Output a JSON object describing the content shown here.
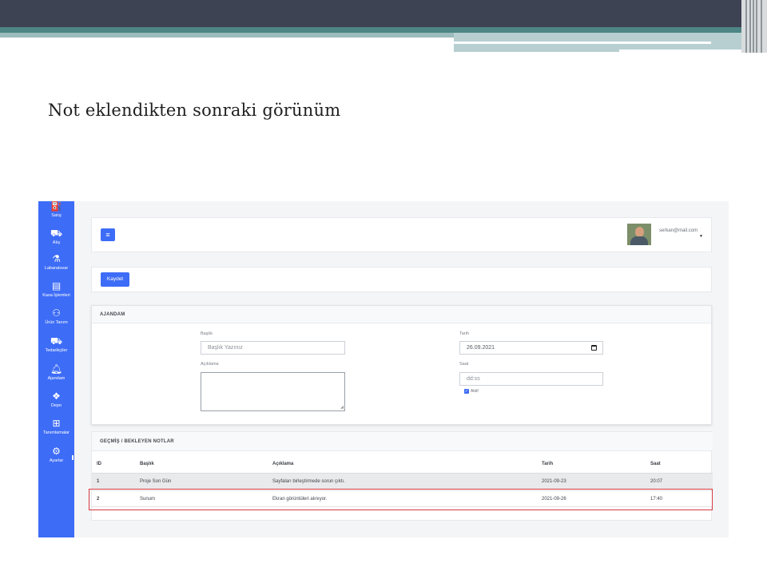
{
  "slide": {
    "title": "Not eklendikten sonraki görünüm"
  },
  "sidebar": {
    "items": [
      {
        "label": "Satış",
        "icon": "basket-icon"
      },
      {
        "label": "Alış",
        "icon": "truck-icon"
      },
      {
        "label": "Labaratuvar",
        "icon": "flask-icon"
      },
      {
        "label": "Kasa İşlemleri",
        "icon": "cash-register-icon"
      },
      {
        "label": "Ürün Tanım",
        "icon": "people-carry-icon"
      },
      {
        "label": "Tedarikçiler",
        "icon": "truck-icon"
      },
      {
        "label": "Ajandam",
        "icon": "bell-icon"
      },
      {
        "label": "Depo",
        "icon": "dropbox-icon"
      },
      {
        "label": "Tanımlamalar",
        "icon": "plus-square-icon"
      },
      {
        "label": "Ayarlar",
        "icon": "gear-icon"
      }
    ]
  },
  "header": {
    "menu_icon": "≡",
    "user_email": "serkan@mail.com"
  },
  "toolbar": {
    "save_label": "Kaydet"
  },
  "agenda": {
    "title": "AJANDAM",
    "baslik_label": "Başlık",
    "baslik_placeholder": "Başlık Yazınız",
    "aciklama_label": "Açıklama",
    "tarih_label": "Tarih",
    "tarih_value": "26.09.2021",
    "saat_label": "Saat",
    "saat_placeholder": "dd:ss",
    "aktif_label": "Aktif",
    "aktif_checked": true
  },
  "notes": {
    "title": "GEÇMİŞ / BEKLEYEN NOTLAR",
    "columns": [
      "ID",
      "Başlık",
      "Açıklama",
      "Tarih",
      "Saat"
    ],
    "rows": [
      {
        "id": "1",
        "baslik": "Proje Son Gün",
        "aciklama": "Sayfaları birleştirmede sorun çıktı.",
        "tarih": "2021-09-23",
        "saat": "20:07"
      },
      {
        "id": "2",
        "baslik": "Sunum",
        "aciklama": "Ekran görüntüleri alınıyor.",
        "tarih": "2021-09-26",
        "saat": "17:40"
      }
    ]
  },
  "colors": {
    "primary": "#3d6cf7",
    "highlight": "#d83a3f",
    "band_dark": "#3e4354",
    "band_teal": "#4d8684"
  }
}
